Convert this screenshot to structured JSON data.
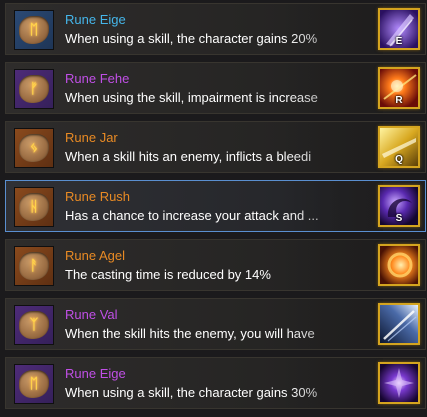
{
  "colors": {
    "name_blue": "#45b6ea",
    "name_purple": "#c04fe6",
    "name_orange": "#e88a24",
    "selected_border": "#5a8fd0",
    "skill_frame_gold": "#d4a41f"
  },
  "runes": [
    {
      "name": "Rune Eige",
      "tier": "blue",
      "description": "When using a skill, the character gains 20%",
      "skill_key": "E",
      "icon": "purple-blade-skill-icon",
      "selected": false
    },
    {
      "name": "Rune Fehe",
      "tier": "purple",
      "description": "When using the skill, impairment is increase",
      "skill_key": "R",
      "icon": "fire-burst-skill-icon",
      "selected": false
    },
    {
      "name": "Rune Jar",
      "tier": "orange",
      "description": "When a skill hits an enemy, inflicts a bleedi",
      "skill_key": "Q",
      "icon": "golden-slash-skill-icon",
      "selected": false
    },
    {
      "name": "Rune Rush",
      "tier": "orange",
      "description": "Has a chance to increase your attack and ...",
      "skill_key": "S",
      "icon": "shadow-swirl-skill-icon",
      "selected": true
    },
    {
      "name": "Rune Agel",
      "tier": "orange",
      "description": "The casting time is reduced by 14%",
      "skill_key": "",
      "icon": "flame-ring-skill-icon",
      "selected": false
    },
    {
      "name": "Rune Val",
      "tier": "purple",
      "description": "When the skill hits the enemy, you will have",
      "skill_key": "",
      "icon": "ice-slash-skill-icon",
      "selected": false
    },
    {
      "name": "Rune Eige",
      "tier": "purple",
      "description": "When using a skill, the character gains 30%",
      "skill_key": "",
      "icon": "void-star-skill-icon",
      "selected": false
    }
  ]
}
